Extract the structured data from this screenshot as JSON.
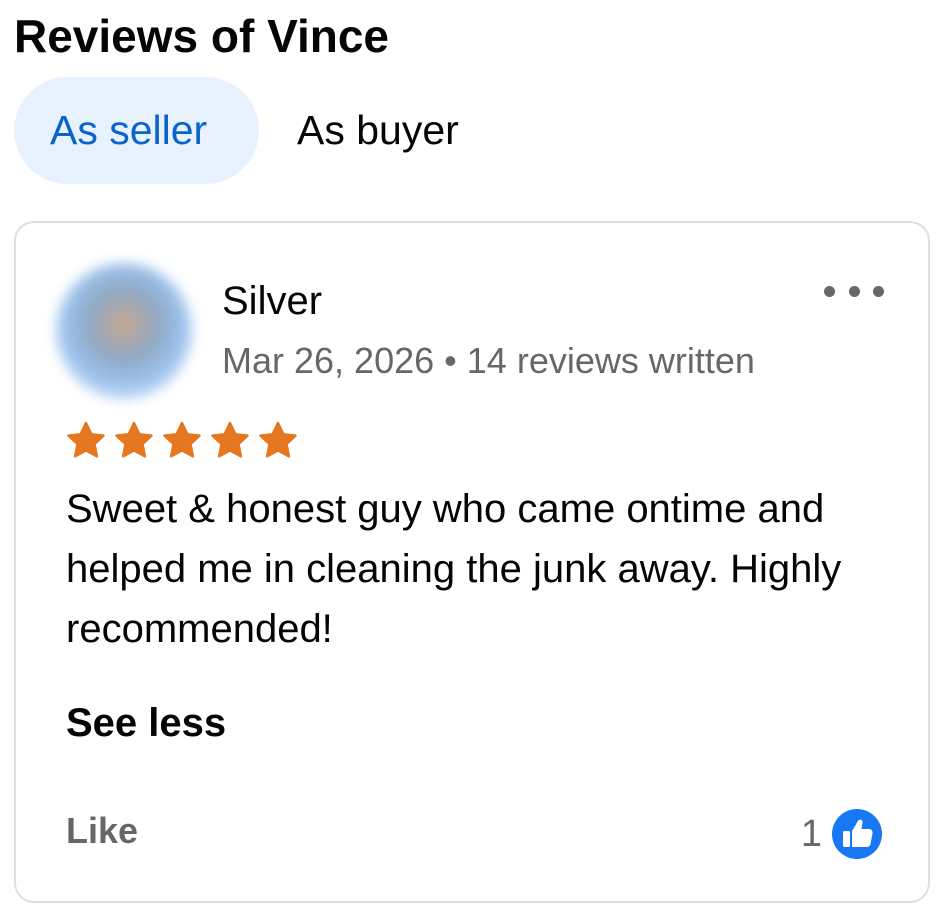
{
  "header": {
    "title": "Reviews of Vince"
  },
  "tabs": [
    {
      "label": "As seller",
      "active": true
    },
    {
      "label": "As buyer",
      "active": false
    }
  ],
  "review": {
    "reviewer_name": "Silver",
    "date": "Mar 26, 2026",
    "separator": "•",
    "reviews_written": "14 reviews written",
    "rating": 5,
    "rating_max": 5,
    "text": "Sweet & honest guy who came ontime and helped me in cleaning the junk away. Highly recommended!",
    "see_less_label": "See less",
    "like_label": "Like",
    "like_count": "1"
  },
  "colors": {
    "accent": "#0a64c9",
    "tab_active_bg": "#e7f2fe",
    "star": "#e4771f",
    "like_icon": "#1877f2",
    "secondary_text": "#65676b"
  },
  "icons": {
    "more": "more-horizontal-icon",
    "star": "star-icon",
    "like": "thumbs-up-icon"
  }
}
